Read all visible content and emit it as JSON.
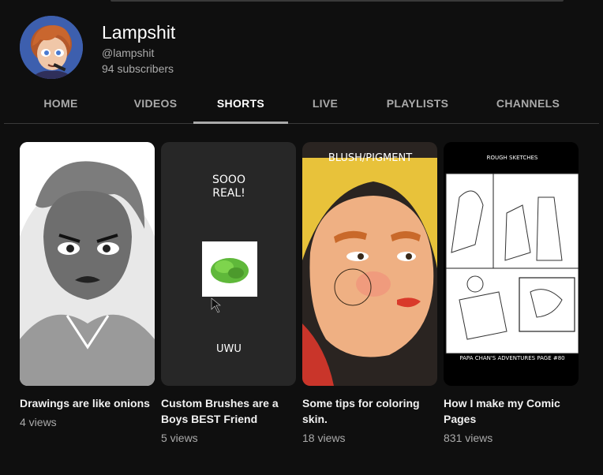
{
  "channel": {
    "name": "Lampshit",
    "handle": "@lampshit",
    "subscribers": "94 subscribers"
  },
  "tabs": [
    {
      "label": "HOME",
      "active": false
    },
    {
      "label": "VIDEOS",
      "active": false
    },
    {
      "label": "SHORTS",
      "active": true
    },
    {
      "label": "LIVE",
      "active": false
    },
    {
      "label": "PLAYLISTS",
      "active": false
    },
    {
      "label": "CHANNELS",
      "active": false
    }
  ],
  "shorts": [
    {
      "title": "Drawings are like onions",
      "views": "4 views",
      "thumb_text": []
    },
    {
      "title": "Custom Brushes are a Boys BEST Friend",
      "views": "5 views",
      "thumb_text": [
        "SOOO",
        "REAL!",
        "UWU"
      ]
    },
    {
      "title": "Some tips for coloring skin.",
      "views": "18 views",
      "thumb_text": [
        "BLUSH/PIGMENT"
      ]
    },
    {
      "title": "How I make my Comic Pages",
      "views": "831 views",
      "thumb_text": [
        "ROUGH SKETCHES",
        "PAPA CHAN'S ADVENTURES PAGE #80"
      ]
    }
  ],
  "colors": {
    "background": "#0f0f0f",
    "text_primary": "#f1f1f1",
    "text_secondary": "#aaaaaa",
    "avatar_bg": "#3d5fae"
  }
}
